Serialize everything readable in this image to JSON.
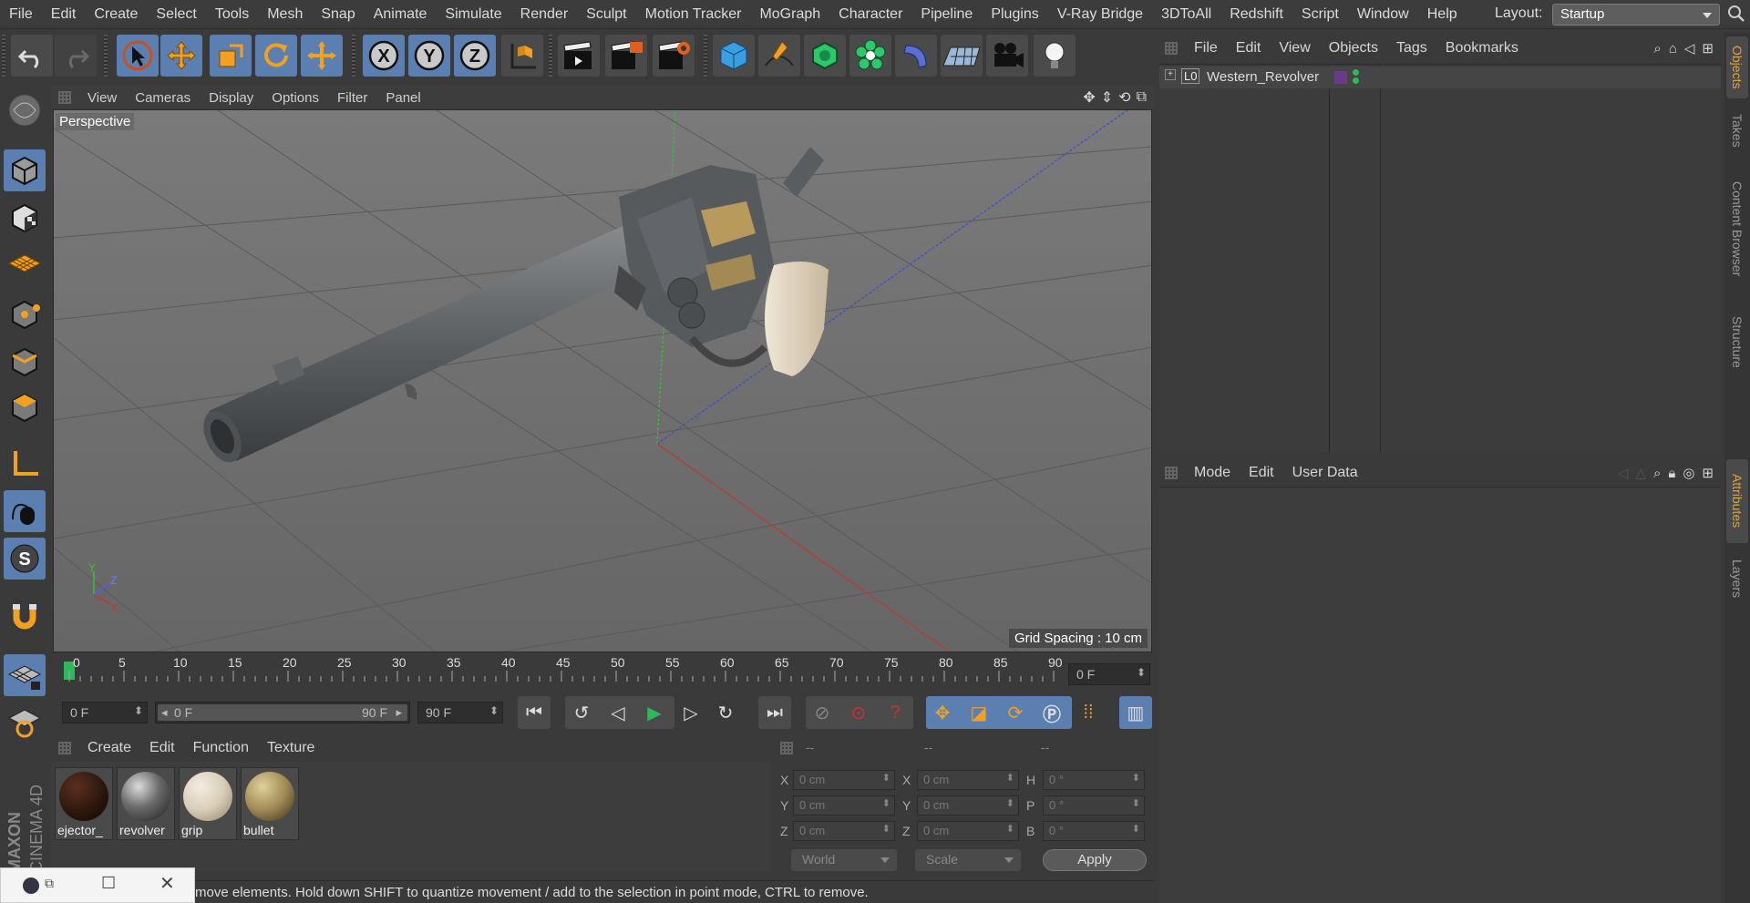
{
  "menubar": {
    "items": [
      "File",
      "Edit",
      "Create",
      "Select",
      "Tools",
      "Mesh",
      "Snap",
      "Animate",
      "Simulate",
      "Render",
      "Sculpt",
      "Motion Tracker",
      "MoGraph",
      "Character",
      "Pipeline",
      "Plugins",
      "V-Ray Bridge",
      "3DToAll",
      "Redshift",
      "Script",
      "Window",
      "Help"
    ],
    "layout_label": "Layout:",
    "layout_value": "Startup"
  },
  "toolbar": {
    "axis_x": "X",
    "axis_y": "Y",
    "axis_z": "Z"
  },
  "viewport": {
    "menu": [
      "View",
      "Cameras",
      "Display",
      "Options",
      "Filter",
      "Panel"
    ],
    "label": "Perspective",
    "grid_spacing": "Grid Spacing : 10 cm",
    "axis_labels": {
      "y": "Y",
      "z": "Z",
      "x": "X"
    }
  },
  "timeline": {
    "ticks": [
      "0",
      "5",
      "10",
      "15",
      "20",
      "25",
      "30",
      "35",
      "40",
      "45",
      "50",
      "55",
      "60",
      "65",
      "70",
      "75",
      "80",
      "85",
      "90"
    ],
    "current_frame": "0 F",
    "start_frame": "0 F",
    "range_start": "0 F",
    "range_end": "90 F",
    "end_frame": "90 F"
  },
  "materials": {
    "menu": [
      "Create",
      "Edit",
      "Function",
      "Texture"
    ],
    "items": [
      {
        "name": "ejector_",
        "color": "#2a150c"
      },
      {
        "name": "revolver",
        "color": "#6a6a6a"
      },
      {
        "name": "grip",
        "color": "#d9cdb8"
      },
      {
        "name": "bullet",
        "color": "#a08a55"
      }
    ]
  },
  "coordinates": {
    "headers": [
      "--",
      "--",
      "--"
    ],
    "rows": [
      {
        "l1": "X",
        "v1": "0 cm",
        "l2": "X",
        "v2": "0 cm",
        "l3": "H",
        "v3": "0 °"
      },
      {
        "l1": "Y",
        "v1": "0 cm",
        "l2": "Y",
        "v2": "0 cm",
        "l3": "P",
        "v3": "0 °"
      },
      {
        "l1": "Z",
        "v1": "0 cm",
        "l2": "Z",
        "v2": "0 cm",
        "l3": "B",
        "v3": "0 °"
      }
    ],
    "space": "World",
    "mode": "Scale",
    "apply": "Apply"
  },
  "status": {
    "text": "move elements. Hold down SHIFT to quantize movement / add to the selection in point mode, CTRL to remove."
  },
  "branding": {
    "line1": "MAXON",
    "line2": "CINEMA 4D"
  },
  "objects_panel": {
    "menu": [
      "File",
      "Edit",
      "View",
      "Objects",
      "Tags",
      "Bookmarks"
    ],
    "items": [
      {
        "name": "Western_Revolver"
      }
    ]
  },
  "attributes_panel": {
    "menu": [
      "Mode",
      "Edit",
      "User Data"
    ]
  },
  "right_tabs": {
    "top": [
      "Objects",
      "Takes",
      "Content Browser",
      "Structure"
    ],
    "bottom": [
      "Attributes",
      "Layers"
    ]
  },
  "colors": {
    "accent_blue": "#5b7fb0",
    "accent_orange": "#e8a33a",
    "axis_x": "#c0392b",
    "axis_y": "#3bbf3b",
    "axis_z": "#4a5cff"
  }
}
